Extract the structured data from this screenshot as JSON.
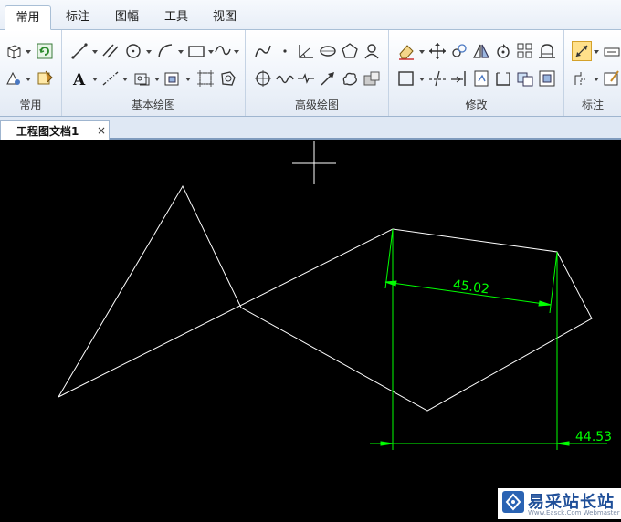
{
  "menu": {
    "tabs": [
      {
        "label": "常用",
        "active": true
      },
      {
        "label": "标注",
        "active": false
      },
      {
        "label": "图幅",
        "active": false
      },
      {
        "label": "工具",
        "active": false
      },
      {
        "label": "视图",
        "active": false
      }
    ]
  },
  "ribbon": {
    "groups": [
      {
        "label": "常用"
      },
      {
        "label": "基本绘图"
      },
      {
        "label": "高级绘图"
      },
      {
        "label": "修改"
      },
      {
        "label": "标注"
      }
    ],
    "text_tool_glyph": "A"
  },
  "document": {
    "tab_label": "工程图文档1",
    "close_glyph": "×"
  },
  "drawing": {
    "dimension_1": "45.02",
    "dimension_2": "44.53",
    "line_color": "#ffffff",
    "dimension_color": "#00ff00"
  },
  "watermark": {
    "text": "易采站长站",
    "sub": "Www.Easck.Com Webmaster"
  },
  "colors": {
    "accent": "#2a63b3",
    "ribbon_border": "#9fb5cf"
  }
}
